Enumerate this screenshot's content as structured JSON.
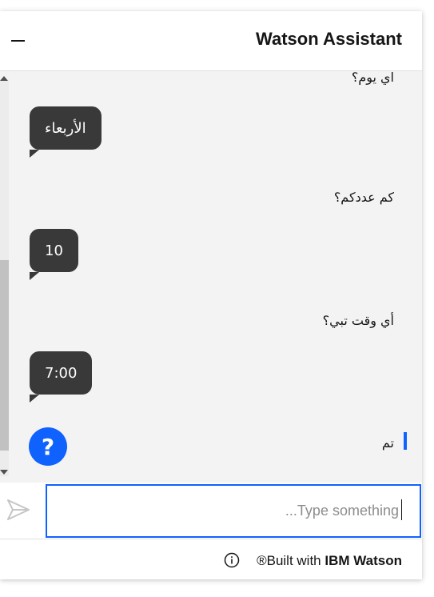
{
  "header": {
    "title": "Watson Assistant",
    "minimize_icon": "minimize-icon"
  },
  "conversation": [
    {
      "from": "user",
      "text": "اي يوم؟"
    },
    {
      "from": "bot",
      "text": "الأربعاء"
    },
    {
      "from": "user",
      "text": "كم عددكم؟"
    },
    {
      "from": "bot",
      "text": "10"
    },
    {
      "from": "user",
      "text": "أي وقت تبي؟"
    },
    {
      "from": "bot",
      "text": "7:00"
    },
    {
      "from": "user",
      "text": "تم"
    }
  ],
  "help_button": {
    "label": "?",
    "icon": "help-icon",
    "color": "#0f62fe"
  },
  "input": {
    "placeholder": "...Type something",
    "value": "",
    "send_icon": "send-icon"
  },
  "footer": {
    "icon": "info-icon",
    "prefix": "®Built with ",
    "brand": "IBM Watson"
  },
  "colors": {
    "accent": "#0f62fe",
    "bot_bubble": "#393939",
    "chat_background": "#f3f3f3"
  }
}
